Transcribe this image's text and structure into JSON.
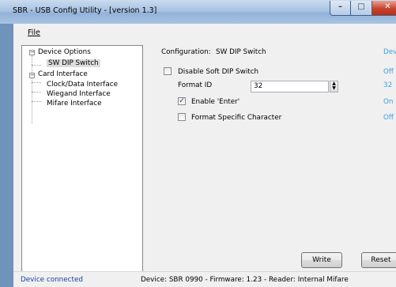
{
  "window": {
    "title": "SBR - USB Config Utility - [version 1.3]",
    "minimize_glyph": "–",
    "maximize_glyph": "□",
    "close_glyph": "✕"
  },
  "menu": {
    "file": "File"
  },
  "tree": {
    "items": [
      {
        "label": "Device Options",
        "expander": "−"
      },
      {
        "label": "SW DIP Switch"
      },
      {
        "label": "Card Interface",
        "expander": "−"
      },
      {
        "label": "Clock/Data Interface"
      },
      {
        "label": "Wiegand Interface"
      },
      {
        "label": "Mifare Interface"
      }
    ]
  },
  "config": {
    "header_label": "Configuration:",
    "header_value": "SW DIP Switch",
    "device_value_heading": "Device Value",
    "disable_soft_dip": {
      "label": "Disable Soft DIP Switch",
      "checked": false,
      "device_value": "Off"
    },
    "format_id": {
      "label": "Format ID",
      "value": "32",
      "device_value": "32"
    },
    "enable_enter": {
      "label": "Enable 'Enter'",
      "checked": true,
      "mark": "✓",
      "device_value": "On"
    },
    "format_specific_char": {
      "label": "Format Specific Character",
      "checked": false,
      "device_value": "Off"
    }
  },
  "buttons": {
    "write": "Write",
    "reset": "Reset"
  },
  "status": {
    "connection": "Device connected",
    "info": "Device: SBR 0990 - Firmware: 1.23 - Reader: Internal Mifare"
  },
  "colors": {
    "device_value": "#3aa0e0",
    "status_connected": "#1a3fa0",
    "titlebar": "#a9c3e2"
  }
}
